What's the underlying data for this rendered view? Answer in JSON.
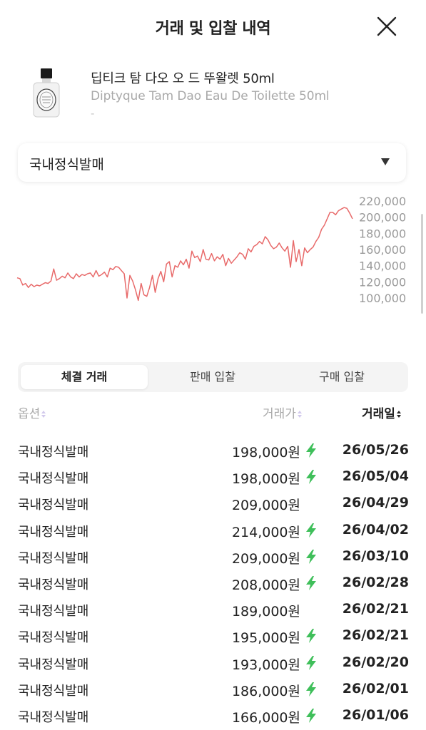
{
  "header": {
    "title": "거래 및 입찰 내역",
    "close_icon": "close-icon"
  },
  "product": {
    "name_ko": "딥티크 탐 다오 오 드 뚜왈렛 50ml",
    "name_en": "Diptyque Tam Dao Eau De Toilette 50ml",
    "sub": "-"
  },
  "option_select": {
    "value": "국내정식발매",
    "arrow_icon": "triangle-down-icon"
  },
  "chart_data": {
    "type": "line",
    "color": "#e86a6a",
    "y_tick_labels": [
      "220,000",
      "200,000",
      "180,000",
      "160,000",
      "140,000",
      "120,000",
      "100,000"
    ],
    "ylim": [
      100000,
      220000
    ],
    "grid": false,
    "x": [
      0,
      1,
      2,
      3,
      4,
      5,
      6,
      7,
      8,
      9,
      10,
      11,
      12,
      13,
      14,
      15,
      16,
      17,
      18,
      19,
      20,
      21,
      22,
      23,
      24,
      25,
      26,
      27,
      28,
      29,
      30,
      31,
      32,
      33,
      34,
      35,
      36,
      37,
      38,
      39,
      40,
      41,
      42,
      43,
      44,
      45,
      46,
      47,
      48,
      49,
      50,
      51,
      52,
      53,
      54,
      55,
      56,
      57,
      58,
      59,
      60,
      61,
      62,
      63,
      64,
      65,
      66,
      67,
      68,
      69,
      70,
      71,
      72,
      73,
      74,
      75,
      76,
      77,
      78,
      79,
      80,
      81,
      82,
      83,
      84,
      85,
      86,
      87,
      88,
      89,
      90,
      91,
      92,
      93,
      94,
      95,
      96,
      97,
      98,
      99,
      100,
      101,
      102,
      103,
      104,
      105,
      106,
      107,
      108,
      109,
      110,
      111,
      112,
      113,
      114,
      115,
      116,
      117,
      118,
      119
    ],
    "values": [
      125000,
      124000,
      116000,
      118000,
      113000,
      117000,
      114000,
      116000,
      115000,
      117000,
      119000,
      118000,
      121000,
      136000,
      122000,
      124000,
      127000,
      125000,
      131000,
      126000,
      124000,
      130000,
      126000,
      129000,
      128000,
      130000,
      131000,
      126000,
      134000,
      127000,
      129000,
      132000,
      126000,
      137000,
      135000,
      139000,
      138000,
      134000,
      130000,
      100000,
      128000,
      121000,
      110000,
      97000,
      118000,
      104000,
      102000,
      113000,
      128000,
      107000,
      124000,
      133000,
      120000,
      142000,
      145000,
      126000,
      140000,
      138000,
      146000,
      141000,
      148000,
      137000,
      158000,
      150000,
      152000,
      145000,
      160000,
      148000,
      147000,
      155000,
      146000,
      151000,
      148000,
      154000,
      140000,
      149000,
      143000,
      147000,
      151000,
      156000,
      154000,
      148000,
      161000,
      157000,
      164000,
      166000,
      170000,
      167000,
      176000,
      172000,
      165000,
      161000,
      163000,
      168000,
      162000,
      158000,
      164000,
      138000,
      171000,
      145000,
      160000,
      140000,
      162000,
      156000,
      160000,
      163000,
      170000,
      175000,
      185000,
      190000,
      198000,
      206000,
      206000,
      203000,
      208000,
      210000,
      212000,
      211000,
      205000,
      198000
    ],
    "title": "",
    "xlabel": "",
    "ylabel": ""
  },
  "tabs": [
    {
      "label": "체결 거래",
      "active": true
    },
    {
      "label": "판매 입찰",
      "active": false
    },
    {
      "label": "구매 입찰",
      "active": false
    }
  ],
  "table": {
    "columns": [
      {
        "label": "옵션",
        "active": false
      },
      {
        "label": "거래가",
        "active": false
      },
      {
        "label": "거래일",
        "active": true
      }
    ],
    "rows": [
      {
        "option": "국내정식발매",
        "price": "198,000원",
        "bolt": true,
        "date": "26/05/26"
      },
      {
        "option": "국내정식발매",
        "price": "198,000원",
        "bolt": true,
        "date": "26/05/04"
      },
      {
        "option": "국내정식발매",
        "price": "209,000원",
        "bolt": false,
        "date": "26/04/29"
      },
      {
        "option": "국내정식발매",
        "price": "214,000원",
        "bolt": true,
        "date": "26/04/02"
      },
      {
        "option": "국내정식발매",
        "price": "209,000원",
        "bolt": true,
        "date": "26/03/10"
      },
      {
        "option": "국내정식발매",
        "price": "208,000원",
        "bolt": true,
        "date": "26/02/28"
      },
      {
        "option": "국내정식발매",
        "price": "189,000원",
        "bolt": false,
        "date": "26/02/21"
      },
      {
        "option": "국내정식발매",
        "price": "195,000원",
        "bolt": true,
        "date": "26/02/21"
      },
      {
        "option": "국내정식발매",
        "price": "193,000원",
        "bolt": true,
        "date": "26/02/20"
      },
      {
        "option": "국내정식발매",
        "price": "186,000원",
        "bolt": true,
        "date": "26/02/01"
      },
      {
        "option": "국내정식발매",
        "price": "166,000원",
        "bolt": true,
        "date": "26/01/06"
      }
    ],
    "bolt_color": "#3fbf5a"
  }
}
